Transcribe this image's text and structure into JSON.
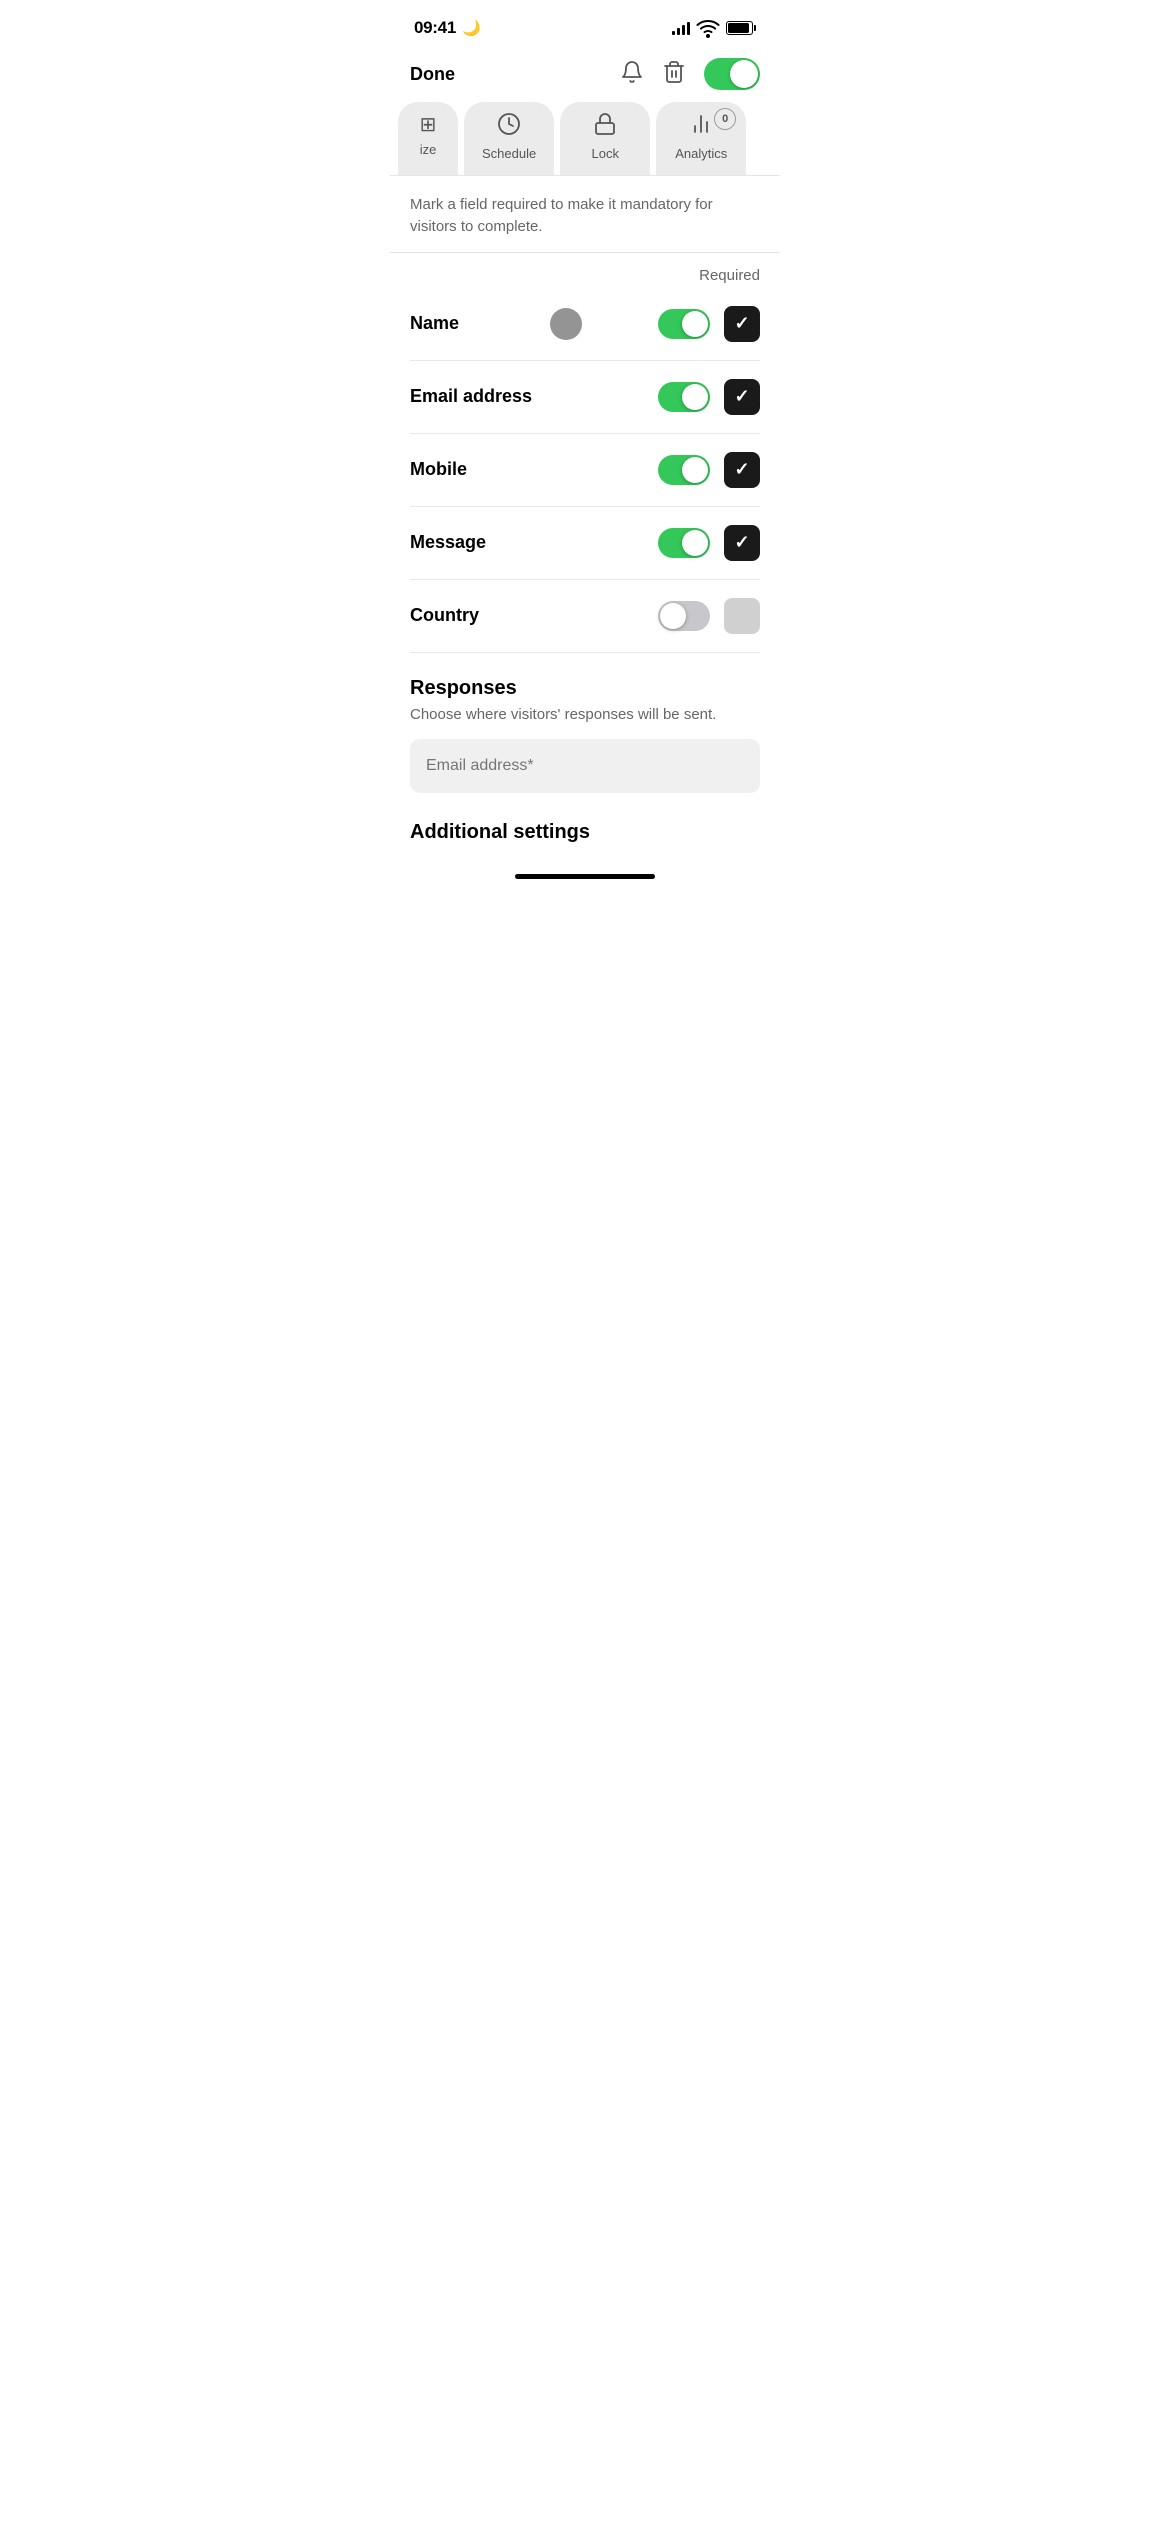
{
  "statusBar": {
    "time": "09:41",
    "moon": "🌙"
  },
  "navBar": {
    "doneLabel": "Done"
  },
  "globalToggle": {
    "on": true
  },
  "tabs": [
    {
      "id": "size",
      "label": "ize",
      "icon": "size",
      "active": false,
      "badge": null
    },
    {
      "id": "schedule",
      "label": "Schedule",
      "icon": "clock",
      "active": false,
      "badge": null
    },
    {
      "id": "lock",
      "label": "Lock",
      "icon": "lock",
      "active": false,
      "badge": null
    },
    {
      "id": "analytics",
      "label": "Analytics",
      "icon": "chart",
      "active": false,
      "badge": "0"
    }
  ],
  "description": {
    "text": "Mark a field required to make it mandatory for visitors to complete."
  },
  "requiredHeader": "Required",
  "fields": [
    {
      "id": "name",
      "label": "Name",
      "enabled": true,
      "required": true
    },
    {
      "id": "email",
      "label": "Email address",
      "enabled": true,
      "required": true
    },
    {
      "id": "mobile",
      "label": "Mobile",
      "enabled": true,
      "required": true
    },
    {
      "id": "message",
      "label": "Message",
      "enabled": true,
      "required": true
    },
    {
      "id": "country",
      "label": "Country",
      "enabled": false,
      "required": false
    }
  ],
  "responses": {
    "title": "Responses",
    "subtitle": "Choose where visitors' responses will be sent.",
    "emailPlaceholder": "Email address*"
  },
  "additionalSettings": {
    "title": "Additional settings"
  }
}
